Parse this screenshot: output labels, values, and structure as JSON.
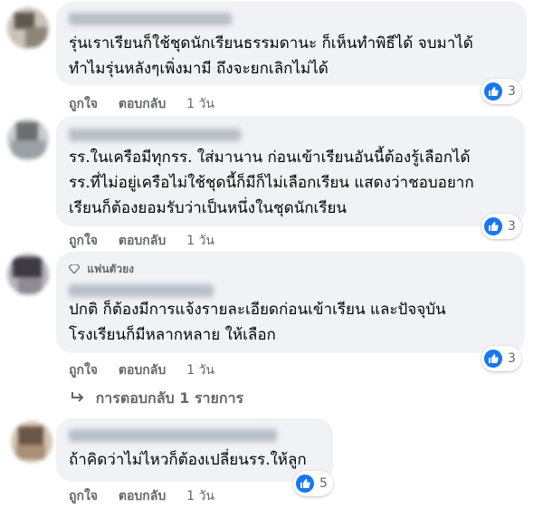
{
  "comments": [
    {
      "text": "รุ่นเราเรียนก็ใช้ชุดนักเรียนธรรมดานะ ก็เห็นทำพิธีได้ จบมาได้\nทำไมรุ่นหลังๆเพิ่งมามี ถึงจะยกเลิกไม่ได้",
      "like": "ถูกใจ",
      "reply": "ตอบกลับ",
      "time": "1 วัน",
      "reactions": "3"
    },
    {
      "text": "รร.ในเครือมีทุกรร. ใส่มานาน ก่อนเข้าเรียนอันนี้ต้องรู้เลือกได้\nรร.ที่ไม่อยู่เครือไม่ใช้ชุดนี้ก็มีก็ไม่เลือกเรียน แสดงว่าชอบอยาก\nเรียนก็ต้องยอมรับว่าเป็นหนึ่งในชุดนักเรียน",
      "like": "ถูกใจ",
      "reply": "ตอบกลับ",
      "time": "1 วัน",
      "reactions": "3"
    },
    {
      "badge": "แฟนตัวยง",
      "text": "ปกติ ก็ต้องมีการแจ้งรายละเอียดก่อนเข้าเรียน และปัจจุบัน\nโรงเรียนก็มีหลากหลาย ให้เลือก",
      "like": "ถูกใจ",
      "reply": "ตอบกลับ",
      "time": "1 วัน",
      "reactions": "3",
      "replies_label": "การตอบกลับ 1 รายการ"
    },
    {
      "text": "ถ้าคิดว่าไม่ไหวก็ต้องเปลี่ยนรร.ให้ลูก",
      "like": "ถูกใจ",
      "reply": "ตอบกลับ",
      "time": "1 วัน",
      "reactions": "5"
    }
  ],
  "colors": {
    "bubble": "#f0f2f5",
    "like_blue": "#1877f2",
    "meta_text": "#65676b"
  },
  "icons": [
    "thumbs-up-icon",
    "diamond-icon",
    "reply-arrow-icon"
  ]
}
